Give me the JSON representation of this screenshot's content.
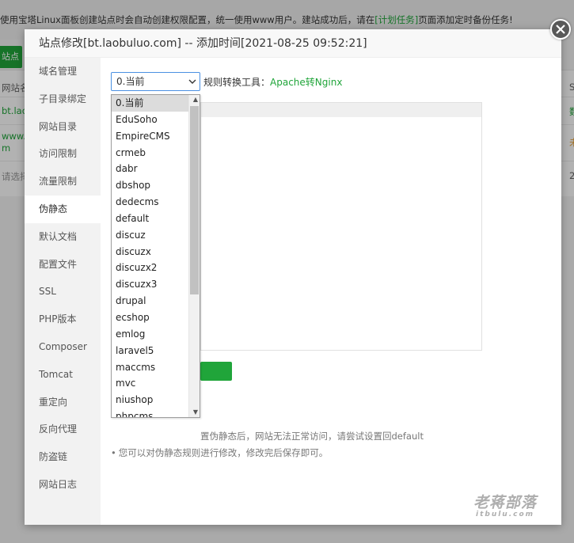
{
  "background": {
    "notice_prefix": "使用宝塔Linux面板创建站点时会自动创建权限配置，统一使用www用户。建站成功后，请在",
    "notice_link": "[计划任务]",
    "notice_suffix": "页面添加定时备份任务!",
    "add_site_label": "站点",
    "col_site_name": "网站名",
    "row1_name": "bt.lao",
    "row2_name_a": "www.l",
    "row2_name_b": "m",
    "select_placeholder": "请选择",
    "right_col_header": "S",
    "row1_right": "数",
    "row2_right": "未",
    "row3_right": "2"
  },
  "modal": {
    "title": "站点修改[bt.laobuluo.com] -- 添加时间[2021-08-25 09:52:21]",
    "close_glyph": "✕"
  },
  "sidebar": {
    "items": [
      {
        "label": "域名管理",
        "active": false
      },
      {
        "label": "子目录绑定",
        "active": false
      },
      {
        "label": "网站目录",
        "active": false
      },
      {
        "label": "访问限制",
        "active": false
      },
      {
        "label": "流量限制",
        "active": false
      },
      {
        "label": "伪静态",
        "active": true
      },
      {
        "label": "默认文档",
        "active": false
      },
      {
        "label": "配置文件",
        "active": false
      },
      {
        "label": "SSL",
        "active": false
      },
      {
        "label": "PHP版本",
        "active": false
      },
      {
        "label": "Composer",
        "active": false
      },
      {
        "label": "Tomcat",
        "active": false
      },
      {
        "label": "重定向",
        "active": false
      },
      {
        "label": "反向代理",
        "active": false
      },
      {
        "label": "防盗链",
        "active": false
      },
      {
        "label": "网站日志",
        "active": false
      }
    ]
  },
  "rewrite": {
    "selected_value": "0.当前",
    "tool_label": "规则转换工具：",
    "tool_link": "Apache转Nginx",
    "tip1": "置伪静态后，网站无法正常访问，请尝试设置回default",
    "tip2": "您可以对伪静态规则进行修改，修改完后保存即可。",
    "options": [
      "0.当前",
      "EduSoho",
      "EmpireCMS",
      "crmeb",
      "dabr",
      "dbshop",
      "dedecms",
      "default",
      "discuz",
      "discuzx",
      "discuzx2",
      "discuzx3",
      "drupal",
      "ecshop",
      "emlog",
      "laravel5",
      "maccms",
      "mvc",
      "niushop",
      "phpcms"
    ]
  },
  "watermark": {
    "cn": "老蒋部落",
    "en": "itbulu.com"
  },
  "colors": {
    "accent": "#20a53a",
    "select_border": "#4a90e2",
    "sidebar_bg": "#f2f2f2"
  }
}
